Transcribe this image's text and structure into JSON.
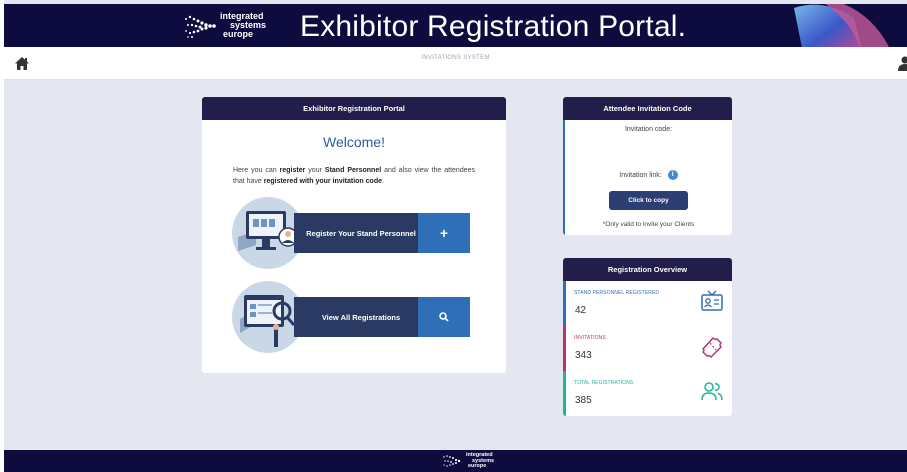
{
  "banner": {
    "logo_lines": [
      "integrated",
      "systems",
      "europe"
    ],
    "title": "Exhibitor Registration Portal."
  },
  "topbar": {
    "system_label": "INVITATIONS SYSTEM"
  },
  "main_card": {
    "header": "Exhibitor Registration Portal",
    "welcome": "Welcome!",
    "intro": {
      "t1": "Here you can ",
      "b1": "register",
      "t2": " your ",
      "b2": "Stand Personnel",
      "t3": " and also view the attendees that have ",
      "b3": "registered with your invitation code",
      "t4": "."
    },
    "register_label": "Register Your Stand Personnel",
    "register_button": "+",
    "view_label": "View All Registrations"
  },
  "invite_card": {
    "header": "Attendee Invitation Code",
    "code_label": "Invitation code:",
    "link_label": "Invitation link:",
    "info": "i",
    "copy_button": "Click to copy",
    "note": "*Only valid to invite your Clients"
  },
  "overview_card": {
    "header": "Registration Overview",
    "stats": [
      {
        "label": "STAND PERSONNEL REGISTERED",
        "value": "42",
        "color": "#2f6fb7",
        "icon": "id-card-icon"
      },
      {
        "label": "INVITATIONS",
        "value": "343",
        "color": "#b8326b",
        "icon": "ticket-icon"
      },
      {
        "label": "TOTAL REGISTRATIONS",
        "value": "385",
        "color": "#1fb59a",
        "icon": "users-icon"
      }
    ]
  },
  "footer": {
    "logo_lines": [
      "integrated",
      "systems",
      "europe"
    ]
  }
}
